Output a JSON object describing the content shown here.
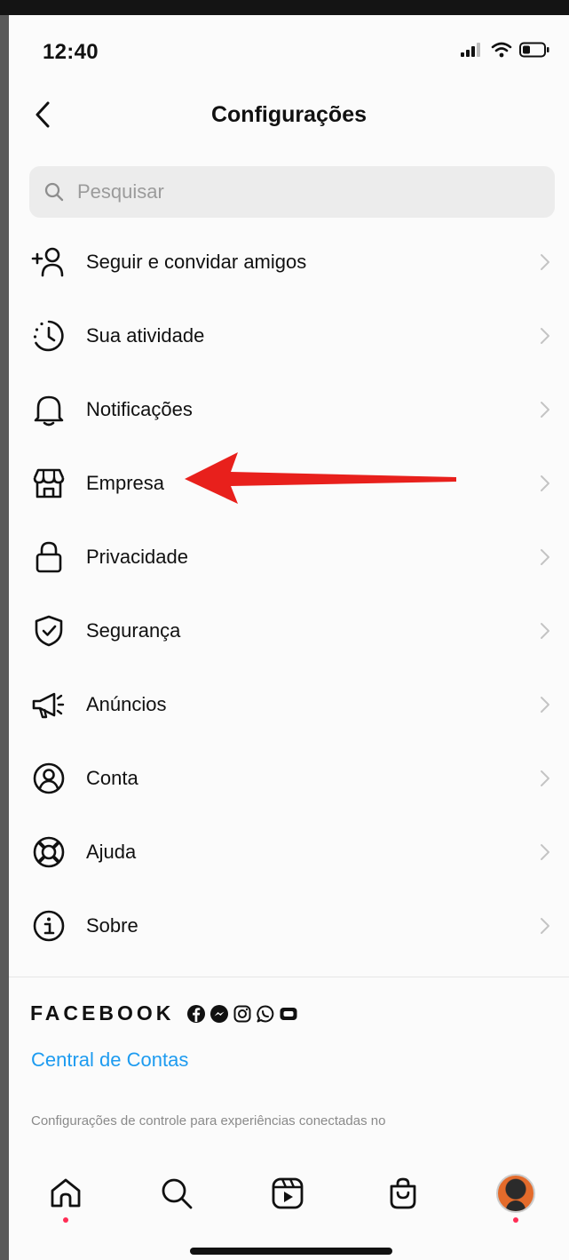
{
  "status_bar": {
    "time": "12:40"
  },
  "header": {
    "title": "Configurações"
  },
  "search": {
    "placeholder": "Pesquisar"
  },
  "menu": {
    "items": [
      {
        "label": "Seguir e convidar amigos",
        "icon": "add-person-icon"
      },
      {
        "label": "Sua atividade",
        "icon": "activity-clock-icon"
      },
      {
        "label": "Notificações",
        "icon": "bell-icon"
      },
      {
        "label": "Empresa",
        "icon": "shop-icon"
      },
      {
        "label": "Privacidade",
        "icon": "lock-icon"
      },
      {
        "label": "Segurança",
        "icon": "shield-check-icon"
      },
      {
        "label": "Anúncios",
        "icon": "megaphone-icon"
      },
      {
        "label": "Conta",
        "icon": "account-circle-icon"
      },
      {
        "label": "Ajuda",
        "icon": "lifebuoy-icon"
      },
      {
        "label": "Sobre",
        "icon": "info-icon"
      }
    ]
  },
  "facebook": {
    "wordmark": "FACEBOOK",
    "accounts_center": "Central de Contas",
    "description": "Configurações de controle para experiências conectadas no"
  },
  "colors": {
    "link": "#1d9bf0",
    "annotation_arrow": "#e8201c",
    "notification_dot": "#ff2d55"
  }
}
